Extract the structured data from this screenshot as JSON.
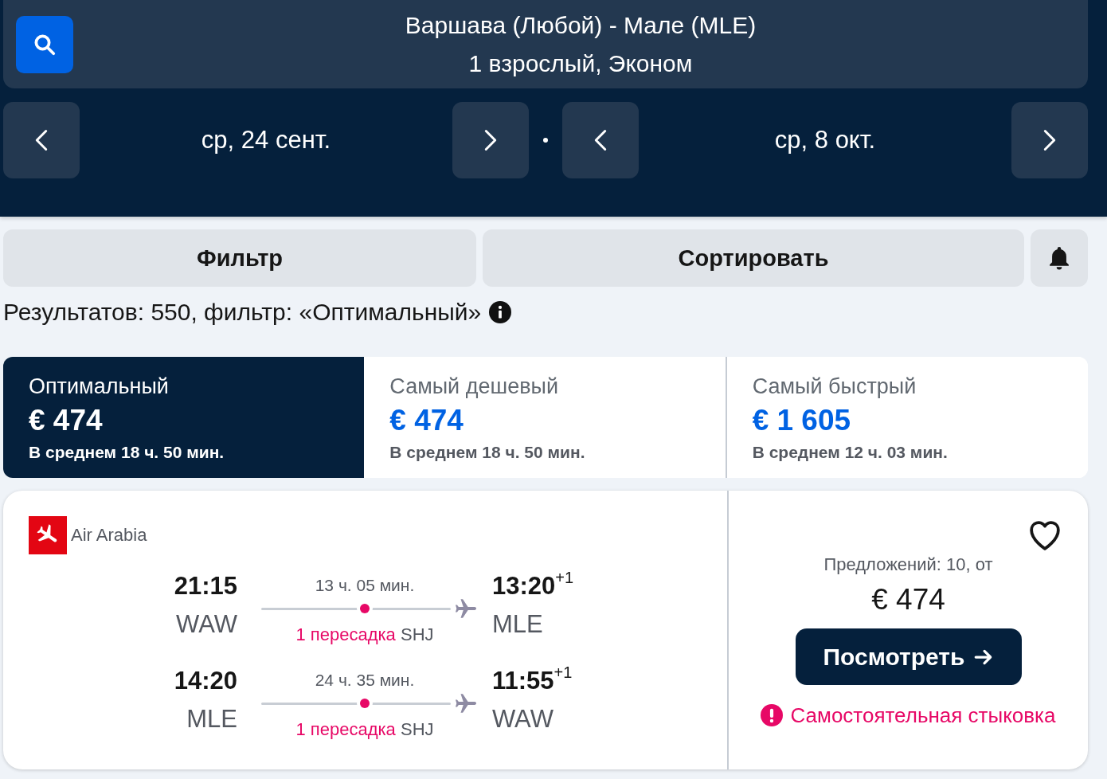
{
  "search": {
    "route": "Варшава (Любой) - Мале (MLE)",
    "passengers": "1 взрослый, Эконом"
  },
  "dates": [
    {
      "label": "ср, 24 сент."
    },
    {
      "label": "ср, 8 окт."
    }
  ],
  "toolbar": {
    "filter": "Фильтр",
    "sort": "Сортировать"
  },
  "summary": "Результатов: 550, фильтр: «Оптимальный»",
  "sort_tabs": [
    {
      "label": "Оптимальный",
      "price": "€ 474",
      "duration": "В среднем 18 ч. 50 мин.",
      "selected": true
    },
    {
      "label": "Самый дешевый",
      "price": "€ 474",
      "duration": "В среднем 18 ч. 50 мин.",
      "selected": false
    },
    {
      "label": "Самый быстрый",
      "price": "€ 1 605",
      "duration": "В среднем 12 ч. 03 мин.",
      "selected": false
    }
  ],
  "results": [
    {
      "airline": "Air Arabia",
      "favorite": false,
      "legs": [
        {
          "depart_time": "21:15",
          "depart_airport": "WAW",
          "duration": "13 ч. 05 мин.",
          "stops": "1 пересадка",
          "via": "SHJ",
          "arrive_time": "13:20",
          "day_offset": "+1",
          "arrive_airport": "MLE"
        },
        {
          "depart_time": "14:20",
          "depart_airport": "MLE",
          "duration": "24 ч. 35 мин.",
          "stops": "1 пересадка",
          "via": "SHJ",
          "arrive_time": "11:55",
          "day_offset": "+1",
          "arrive_airport": "WAW"
        }
      ],
      "offers": "Предложений: 10, от",
      "price": "€ 474",
      "button": "Посмотреть",
      "warning": "Самостоятельная стыковка"
    }
  ]
}
